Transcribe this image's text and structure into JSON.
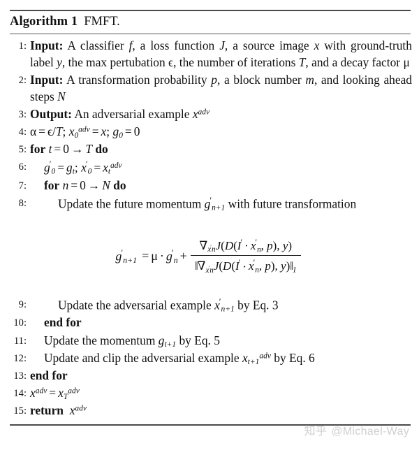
{
  "figure": {
    "kind": "algorithm-pseudocode",
    "title_keyword": "Algorithm 1",
    "title_name": "FMFT."
  },
  "lines": [
    {
      "number": "1:",
      "indent": 0,
      "label": "Input:",
      "text": "A classifier f, a loss function J, a source image x with ground-truth label y, the max pertubation ϵ, the number of iterations T, and a decay factor μ"
    },
    {
      "number": "2:",
      "indent": 0,
      "label": "Input:",
      "text": "A transformation probability p, a block number m, and looking ahead steps N"
    },
    {
      "number": "3:",
      "indent": 0,
      "label": "Output:",
      "text": "An adversarial example x^{adv}"
    },
    {
      "number": "4:",
      "indent": 0,
      "label": "",
      "text": "α = ϵ/T; x_0^{adv} = x; g_0 = 0"
    },
    {
      "number": "5:",
      "indent": 0,
      "label": "for ... do",
      "text": "for t = 0 → T do"
    },
    {
      "number": "6:",
      "indent": 1,
      "label": "",
      "text": "g'_0 = g_t; x'_0 = x_t^{adv}"
    },
    {
      "number": "7:",
      "indent": 1,
      "label": "for ... do",
      "text": "for n = 0 → N do"
    },
    {
      "number": "8:",
      "indent": 2,
      "label": "",
      "text": "Update the future momentum g'_{n+1} with future transformation"
    },
    {
      "number": "9:",
      "indent": 2,
      "label": "",
      "text": "Update the adversarial example x'_{n+1} by Eq. 3"
    },
    {
      "number": "10:",
      "indent": 1,
      "label": "end for",
      "text": "end for"
    },
    {
      "number": "11:",
      "indent": 1,
      "label": "",
      "text": "Update the momentum g_{t+1} by Eq. 5"
    },
    {
      "number": "12:",
      "indent": 1,
      "label": "",
      "text": "Update and clip the adversarial example x_{t+1}^{adv} by Eq. 6"
    },
    {
      "number": "13:",
      "indent": 0,
      "label": "end for",
      "text": "end for"
    },
    {
      "number": "14:",
      "indent": 0,
      "label": "",
      "text": "x^{adv} = x_T^{adv}"
    },
    {
      "number": "15:",
      "indent": 0,
      "label": "return",
      "text": "return x^{adv}"
    }
  ],
  "line_numbers": {
    "n1": "1:",
    "n2": "2:",
    "n3": "3:",
    "n4": "4:",
    "n5": "5:",
    "n6": "6:",
    "n7": "7:",
    "n8": "8:",
    "n9": "9:",
    "n10": "10:",
    "n11": "11:",
    "n12": "12:",
    "n13": "13:",
    "n14": "14:",
    "n15": "15:"
  },
  "keywords": {
    "input": "Input:",
    "output": "Output:",
    "for": "for",
    "do": "do",
    "end_for": "end for",
    "return": "return"
  },
  "text_fragments": {
    "l1_a": "A classifier",
    "l1_b": ", a loss function",
    "l1_c": ", a source image",
    "l1_d": "with ground-truth label",
    "l1_e": ", the max pertubation",
    "l1_f": ", the number of iterations",
    "l1_g": ", and a decay factor",
    "l2_a": "A transformation probability",
    "l2_b": ", a block number",
    "l2_c": ", and looking ahead steps",
    "l3_a": "An adversarial example",
    "l8_a": "Update the future momentum",
    "l8_b": "with future transformation",
    "l9_a": "Update the adversarial example",
    "l9_b": "by Eq. 3",
    "l11_a": "Update the momentum",
    "l11_b": "by Eq. 5",
    "l12_a": "Update and clip the adversarial example",
    "l12_b": "by Eq. 6"
  },
  "symbols": {
    "f": "f",
    "J": "J",
    "x": "x",
    "y": "y",
    "epsilon": "ϵ",
    "T": "T",
    "mu": "μ",
    "alpha": "α",
    "p": "p",
    "m": "m",
    "N": "N",
    "n": "n",
    "t": "t",
    "g": "g",
    "D": "D",
    "I": "I",
    "adv": "adv",
    "zero": "0",
    "one": "1",
    "n_plus_1": "n+1",
    "t_plus_1": "t+1",
    "equals": "=",
    "arrow": "→",
    "semicolon": ";",
    "slash": "/",
    "plus": "+",
    "cdot": "·",
    "nabla": "∇",
    "norm": "‖",
    "prime": "′"
  },
  "equation": {
    "id": "future-momentum-update",
    "latex": "g'_{n+1} = \\mu \\cdot g'_n + \\frac{\\nabla_{x'_n} J(D(I' \\cdot x'_n, p), y)}{\\|\\nabla_{x'_n} J(D(I' \\cdot x'_n, p), y)\\|_1}",
    "lhs": "g'_{n+1}",
    "rhs_term1": "μ · g'_n",
    "numerator": "∇_{x'_n} J(D(I' · x'_n, p), y)",
    "denominator": "‖∇_{x'_n} J(D(I' · x'_n, p), y)‖_1"
  },
  "watermark": {
    "logo": "知乎",
    "handle": "@Michael-Way"
  },
  "colors": {
    "text": "#111111",
    "rule": "#4a4a4a",
    "watermark": "#cfcfcf",
    "background": "#ffffff"
  }
}
